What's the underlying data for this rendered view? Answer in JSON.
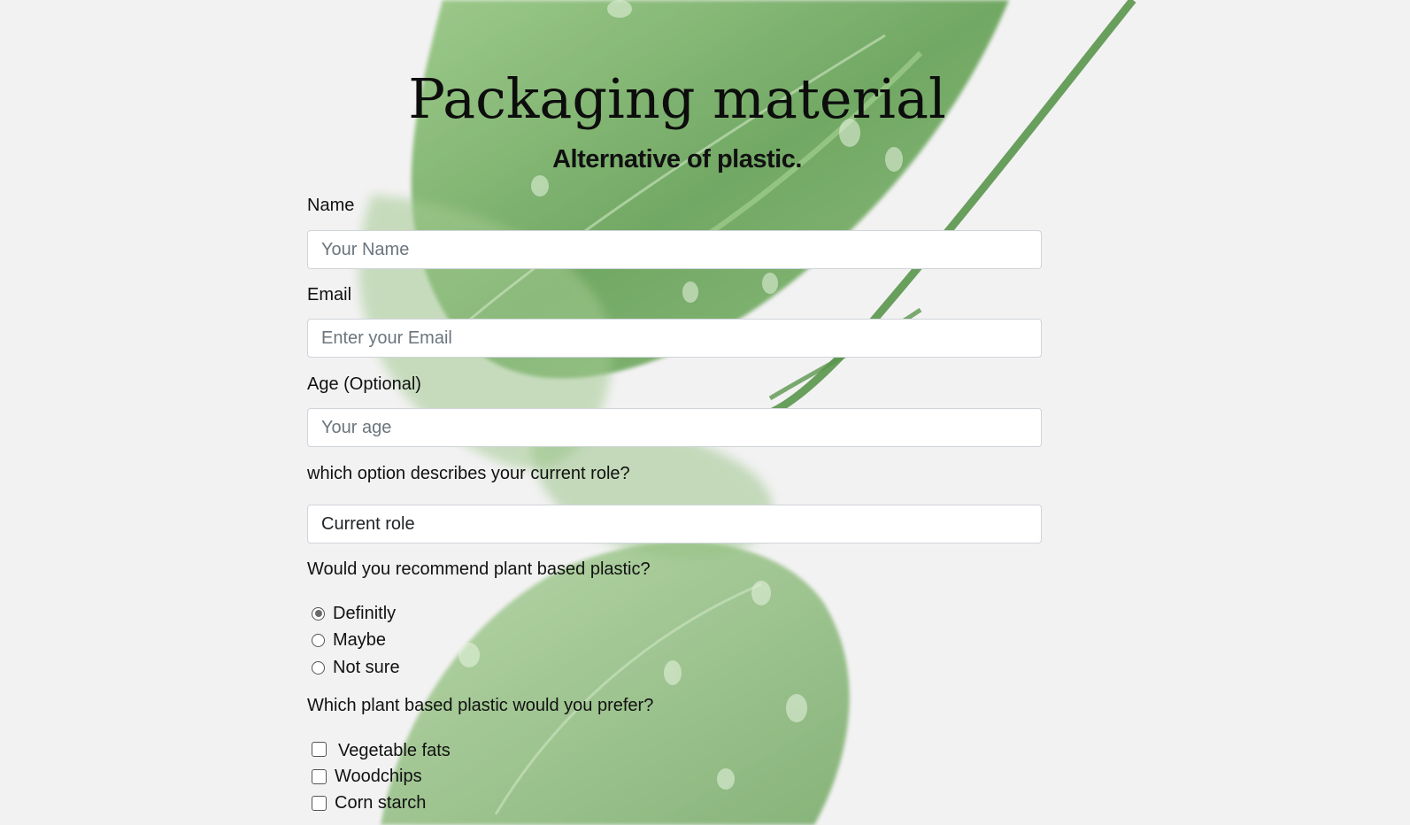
{
  "header": {
    "title": "Packaging material",
    "subtitle": "Alternative of plastic."
  },
  "form": {
    "name": {
      "label": "Name",
      "placeholder": "Your Name"
    },
    "email": {
      "label": "Email",
      "placeholder": "Enter your Email"
    },
    "age": {
      "label": "Age (Optional)",
      "placeholder": "Your age"
    },
    "role": {
      "label": "which option describes your current role?",
      "selected": "Current role"
    },
    "recommend": {
      "label": "Would you recommend plant based plastic?",
      "options": [
        "Definitly",
        "Maybe",
        "Not sure"
      ],
      "selected": "Definitly"
    },
    "prefer": {
      "label": "Which plant based plastic would you prefer?",
      "options": [
        "Vegetable fats",
        "Woodchips",
        "Corn starch"
      ]
    }
  },
  "colors": {
    "background": "#f3f2f3",
    "leaf": "#5a9a4a"
  }
}
